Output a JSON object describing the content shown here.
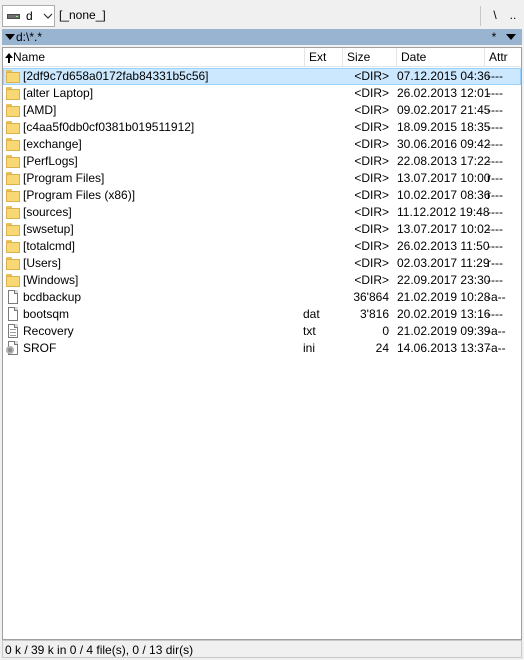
{
  "toolbar": {
    "drive_letter": "d",
    "volume_label": "[_none_]",
    "root_label": "\\",
    "up_label": ".."
  },
  "path_bar": {
    "path": "d:\\*.*",
    "filter_label": "*"
  },
  "columns": {
    "name": "Name",
    "ext": "Ext",
    "size": "Size",
    "date": "Date",
    "attr": "Attr"
  },
  "files": [
    {
      "icon": "folder-icon",
      "name": "[2df9c7d658a0172fab84331b5c56]",
      "ext": "",
      "size": "<DIR>",
      "date": "07.12.2015 04:36",
      "attr": "----",
      "selected": true
    },
    {
      "icon": "folder-icon",
      "name": "[alter Laptop]",
      "ext": "",
      "size": "<DIR>",
      "date": "26.02.2013 12:01",
      "attr": "----"
    },
    {
      "icon": "folder-icon",
      "name": "[AMD]",
      "ext": "",
      "size": "<DIR>",
      "date": "09.02.2017 21:45",
      "attr": "----"
    },
    {
      "icon": "folder-icon",
      "name": "[c4aa5f0db0cf0381b019511912]",
      "ext": "",
      "size": "<DIR>",
      "date": "18.09.2015 18:35",
      "attr": "----"
    },
    {
      "icon": "folder-icon",
      "name": "[exchange]",
      "ext": "",
      "size": "<DIR>",
      "date": "30.06.2016 09:42",
      "attr": "----"
    },
    {
      "icon": "folder-icon",
      "name": "[PerfLogs]",
      "ext": "",
      "size": "<DIR>",
      "date": "22.08.2013 17:22",
      "attr": "----"
    },
    {
      "icon": "folder-icon",
      "name": "[Program Files]",
      "ext": "",
      "size": "<DIR>",
      "date": "13.07.2017 10:00",
      "attr": "r---"
    },
    {
      "icon": "folder-icon",
      "name": "[Program Files (x86)]",
      "ext": "",
      "size": "<DIR>",
      "date": "10.02.2017 08:36",
      "attr": "r---"
    },
    {
      "icon": "folder-icon",
      "name": "[sources]",
      "ext": "",
      "size": "<DIR>",
      "date": "11.12.2012 19:48",
      "attr": "----"
    },
    {
      "icon": "folder-icon",
      "name": "[swsetup]",
      "ext": "",
      "size": "<DIR>",
      "date": "13.07.2017 10:02",
      "attr": "----"
    },
    {
      "icon": "folder-icon",
      "name": "[totalcmd]",
      "ext": "",
      "size": "<DIR>",
      "date": "26.02.2013 11:50",
      "attr": "----"
    },
    {
      "icon": "folder-icon",
      "name": "[Users]",
      "ext": "",
      "size": "<DIR>",
      "date": "02.03.2017 11:29",
      "attr": "r---"
    },
    {
      "icon": "folder-icon",
      "name": "[Windows]",
      "ext": "",
      "size": "<DIR>",
      "date": "22.09.2017 23:30",
      "attr": "----"
    },
    {
      "icon": "blank-file-icon",
      "name": "bcdbackup",
      "ext": "",
      "size": "36'864",
      "date": "21.02.2019 10:28",
      "attr": "-a--"
    },
    {
      "icon": "blank-file-icon",
      "name": "bootsqm",
      "ext": "dat",
      "size": "3'816",
      "date": "20.02.2019 13:16",
      "attr": "----"
    },
    {
      "icon": "text-file-icon",
      "name": "Recovery",
      "ext": "txt",
      "size": "0",
      "date": "21.02.2019 09:39",
      "attr": "-a--"
    },
    {
      "icon": "settings-file-icon",
      "name": "SROF",
      "ext": "ini",
      "size": "24",
      "date": "14.06.2013 13:37",
      "attr": "-a--"
    }
  ],
  "status": {
    "text": "0 k / 39 k in 0 / 4 file(s), 0 / 13 dir(s)"
  }
}
